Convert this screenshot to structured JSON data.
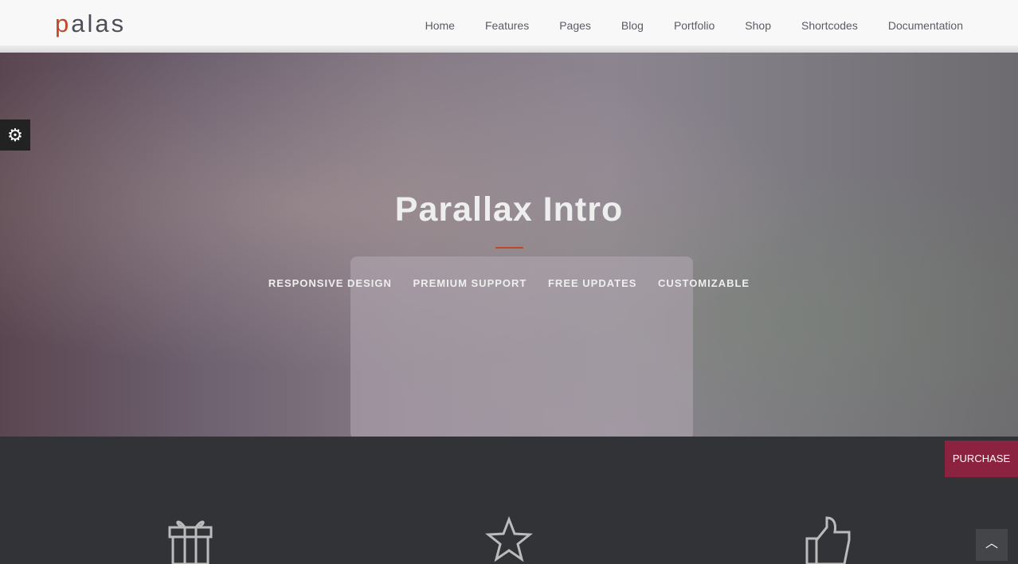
{
  "header": {
    "logo_first": "p",
    "logo_rest": "alas",
    "nav": [
      "Home",
      "Features",
      "Pages",
      "Blog",
      "Portfolio",
      "Shop",
      "Shortcodes",
      "Documentation"
    ]
  },
  "hero": {
    "title": "Parallax Intro",
    "features": [
      "RESPONSIVE DESIGN",
      "PREMIUM SUPPORT",
      "FREE UPDATES",
      "CUSTOMIZABLE"
    ]
  },
  "purchase_label": "PURCHASE",
  "colors": {
    "accent": "#c0472a",
    "purchase": "#8a2240",
    "dark": "#323336"
  }
}
